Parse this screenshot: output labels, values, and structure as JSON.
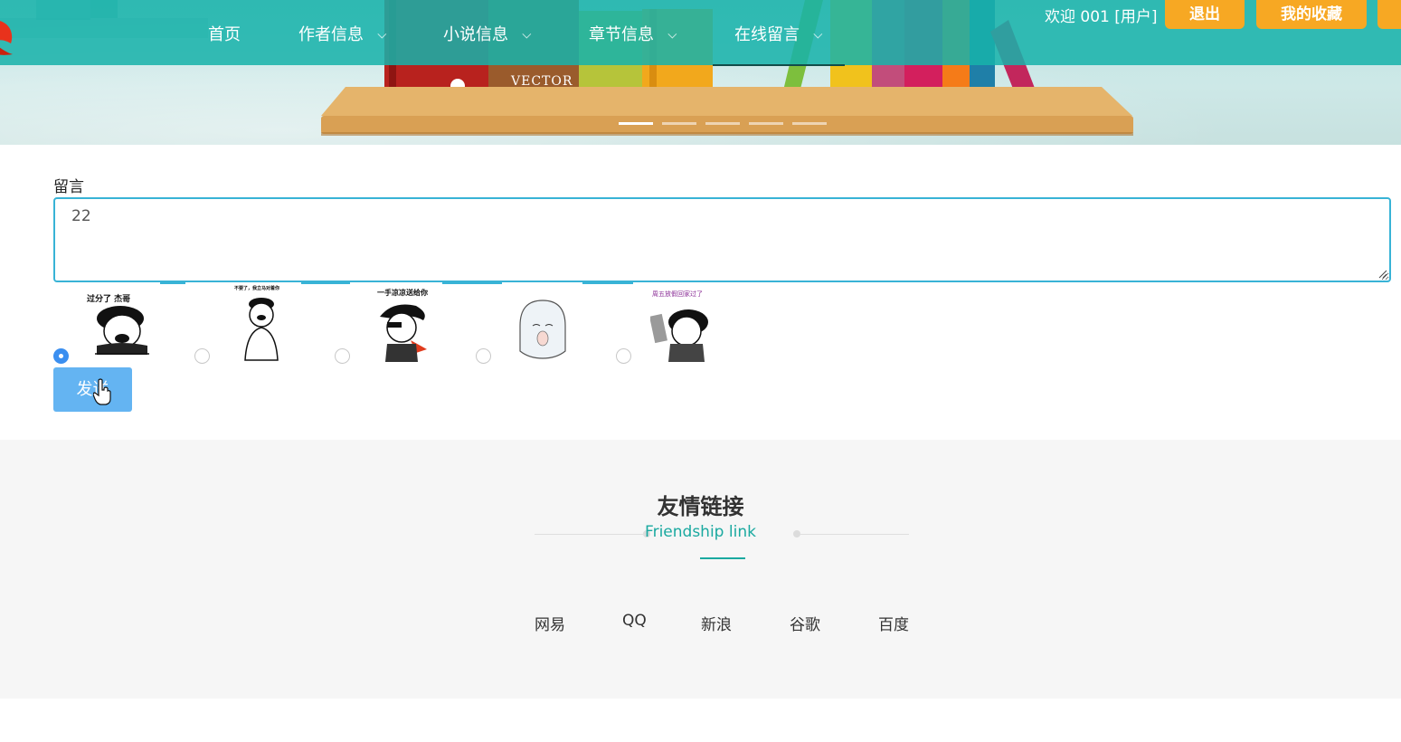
{
  "header": {
    "nav": [
      {
        "label": "首页",
        "has_caret": false
      },
      {
        "label": "作者信息",
        "has_caret": true
      },
      {
        "label": "小说信息",
        "has_caret": true
      },
      {
        "label": "章节信息",
        "has_caret": true
      },
      {
        "label": "在线留言",
        "has_caret": true,
        "active": true
      }
    ],
    "welcome": "欢迎 001 [用户]",
    "logout_label": "退出",
    "favorites_label": "我的收藏",
    "banner_brand": "VECTOR",
    "banner_slides": 5,
    "banner_active_slide": 1
  },
  "form": {
    "label": "留言",
    "message_value": "22",
    "emoticons": [
      {
        "caption": "过分了 杰哥",
        "selected": true
      },
      {
        "caption": "不要了，我立马对着你",
        "selected": false
      },
      {
        "caption": "一手凉凉送给你",
        "selected": false
      },
      {
        "caption": "",
        "selected": false
      },
      {
        "caption": "周五放假回家过了",
        "selected": false
      }
    ],
    "send_label": "发送"
  },
  "footer": {
    "title": "友情链接",
    "subtitle": "Friendship link",
    "links": [
      "网易",
      "QQ",
      "新浪",
      "谷歌",
      "百度"
    ]
  },
  "colors": {
    "nav_bg": "#17b2aa",
    "accent_orange": "#f7a823",
    "input_border": "#38b3d6",
    "send_button": "#64b4f2",
    "footer_accent": "#1aa9a0"
  }
}
